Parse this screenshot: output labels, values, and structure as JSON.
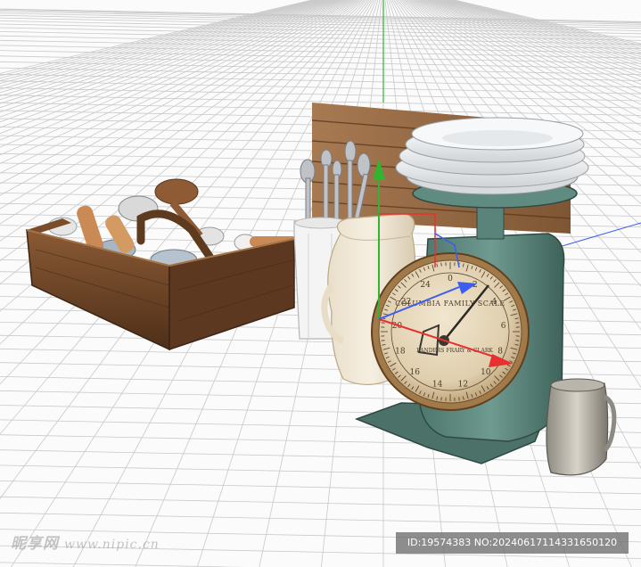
{
  "scene": {
    "description_icons": [
      "wooden-crate",
      "rolling-pin",
      "wooden-spoon",
      "silverware",
      "white-vase",
      "cream-pitcher",
      "green-kitchen-scale",
      "stacked-plates",
      "wood-plank-board",
      "tin-measuring-cup",
      "move-gizmo"
    ],
    "colors": {
      "grid_line": "#c9c9c9",
      "background": "#fbfbfb",
      "scale_body": "#5f8a7f",
      "wood": "#6b4426",
      "axis_x": "#e83030",
      "axis_y": "#2fb52f",
      "axis_z": "#3d5cf0"
    }
  },
  "scale_dial": {
    "brand": "COLUMBIA FAMILY SCALE",
    "maker": "LANDERS FRARY & CLARK",
    "numbers": [
      "0",
      "2",
      "4",
      "6",
      "8",
      "10",
      "12",
      "14",
      "16",
      "18",
      "20",
      "22",
      "24"
    ]
  },
  "watermark": {
    "site_text": "昵享网",
    "site_url": "www.nipic.cn",
    "id_text": "ID:19574383 NO:20240617114331650120"
  }
}
